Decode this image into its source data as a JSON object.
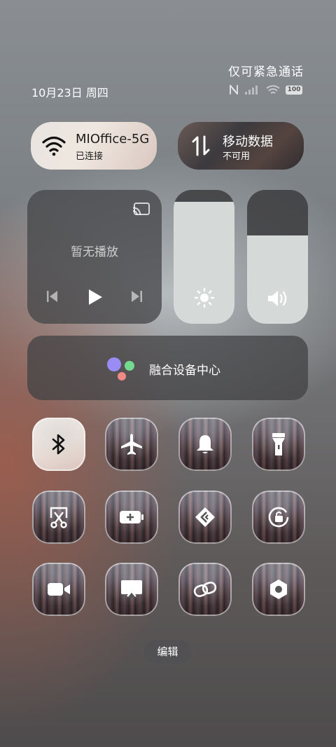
{
  "status": {
    "carrier_text": "仅可紧急通话",
    "date": "10月23日 周四",
    "battery": "100",
    "icons": [
      "nfc-icon",
      "signal-icon",
      "wifi-icon",
      "battery-icon"
    ]
  },
  "wifi": {
    "name": "MIOffice-5G",
    "status": "已连接",
    "active": true
  },
  "mobile_data": {
    "title": "移动数据",
    "status": "不可用",
    "active": false
  },
  "media": {
    "label": "暂无播放"
  },
  "sliders": {
    "brightness_level": 0.91,
    "volume_level": 0.66
  },
  "fusion": {
    "label": "融合设备中心"
  },
  "toggles": [
    {
      "name": "bluetooth",
      "icon": "bluetooth-icon",
      "active": true
    },
    {
      "name": "airplane-mode",
      "icon": "airplane-icon",
      "active": false
    },
    {
      "name": "silent-mode",
      "icon": "bell-icon",
      "active": false
    },
    {
      "name": "flashlight",
      "icon": "flashlight-icon",
      "active": false
    },
    {
      "name": "screenshot",
      "icon": "scissors-icon",
      "active": false
    },
    {
      "name": "battery-saver",
      "icon": "battery-plus-icon",
      "active": false
    },
    {
      "name": "nearby-share",
      "icon": "share-diamond-icon",
      "active": false
    },
    {
      "name": "rotation-lock",
      "icon": "rotation-lock-icon",
      "active": false
    },
    {
      "name": "screen-record",
      "icon": "video-camera-icon",
      "active": false
    },
    {
      "name": "cast",
      "icon": "cast-screen-icon",
      "active": false
    },
    {
      "name": "hotspot-link",
      "icon": "link-icon",
      "active": false
    },
    {
      "name": "settings",
      "icon": "settings-hex-icon",
      "active": false
    }
  ],
  "edit_label": "编辑"
}
